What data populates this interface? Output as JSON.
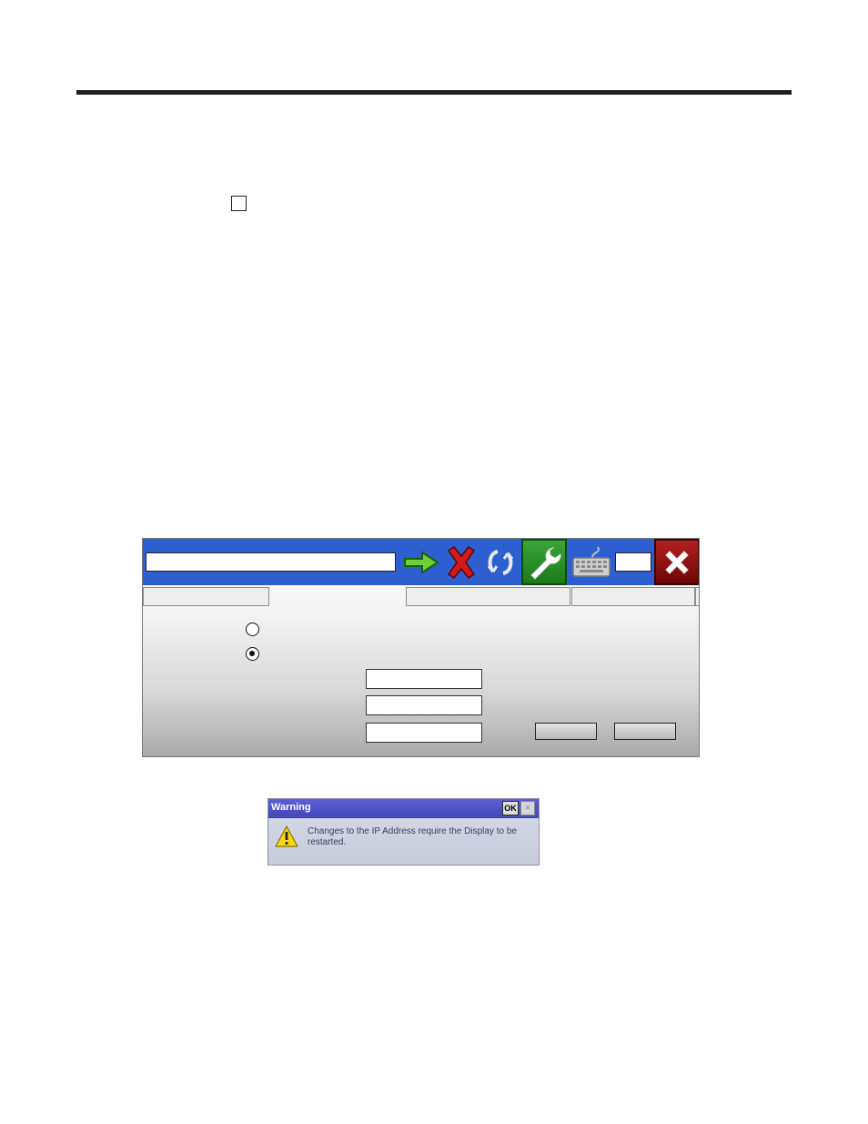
{
  "document": {
    "checkbox_checked": false
  },
  "device_window": {
    "toolbar": {
      "address_value": "",
      "small_field_value": "",
      "icons": [
        "go-arrow-icon",
        "stop-x-icon",
        "refresh-icon",
        "wrench-icon",
        "keyboard-icon",
        "close-x-icon"
      ],
      "colors": {
        "toolbar_bg": "#2e5fd0",
        "settings_bg": "#1f8a1f",
        "close_bg": "#9a1414"
      }
    },
    "tabs": [
      "",
      "",
      "",
      "",
      ""
    ],
    "radio_options": [
      {
        "label": "",
        "selected": false
      },
      {
        "label": "",
        "selected": true
      }
    ],
    "fields": [
      {
        "label": "",
        "value": ""
      },
      {
        "label": "",
        "value": ""
      },
      {
        "label": "",
        "value": ""
      }
    ],
    "buttons": [
      "",
      ""
    ]
  },
  "warning_dialog": {
    "title": "Warning",
    "ok_label": "OK",
    "close_label": "×",
    "message": "Changes to the IP Address require the Display to be restarted.",
    "icon": "warning-icon",
    "colors": {
      "title_bg": "#4c50c8",
      "body_bg": "#cfd3e2"
    }
  }
}
